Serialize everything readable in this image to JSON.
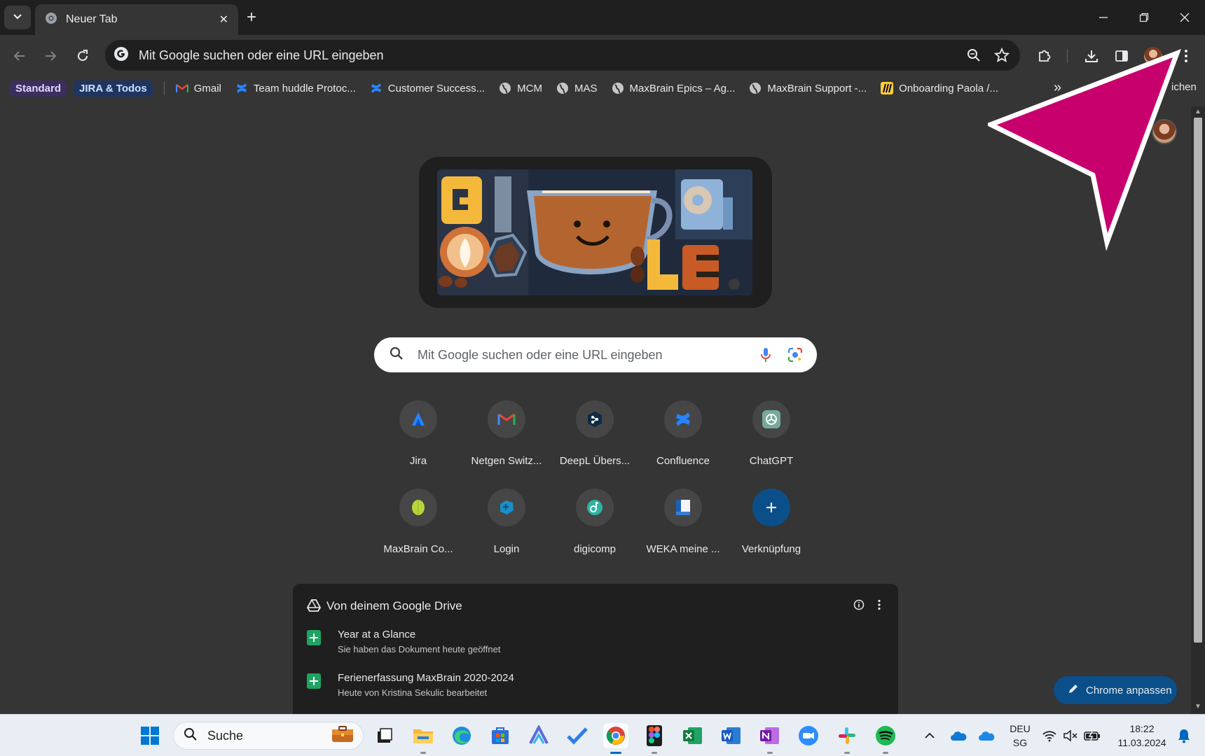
{
  "browser": {
    "tab": {
      "title": "Neuer Tab"
    },
    "omnibox": {
      "text": "Mit Google suchen oder eine URL eingeben"
    },
    "bookmarks": {
      "groups": [
        {
          "label": "Standard",
          "bg": "#3a2f5e",
          "fg": "#e5d7ff"
        },
        {
          "label": "JIRA & Todos",
          "bg": "#1f3560",
          "fg": "#cfe0ff"
        }
      ],
      "items": [
        {
          "label": "Gmail",
          "icon": "gmail-icon"
        },
        {
          "label": "Team huddle Protoc...",
          "icon": "confluence-icon"
        },
        {
          "label": "Customer Success...",
          "icon": "confluence-icon"
        },
        {
          "label": "MCM",
          "icon": "globe-icon"
        },
        {
          "label": "MAS",
          "icon": "globe-icon"
        },
        {
          "label": "MaxBrain Epics – Ag...",
          "icon": "globe-icon"
        },
        {
          "label": "MaxBrain Support -...",
          "icon": "globe-icon"
        },
        {
          "label": "Onboarding Paola /...",
          "icon": "miro-icon"
        }
      ],
      "more": "»",
      "right_fragment": "ichen"
    }
  },
  "newtab": {
    "search": {
      "placeholder": "Mit Google suchen oder eine URL eingeben"
    },
    "shortcuts": [
      {
        "label": "Jira",
        "icon": "jira-icon"
      },
      {
        "label": "Netgen Switz...",
        "icon": "gmail-icon"
      },
      {
        "label": "DeepL Übers...",
        "icon": "deepl-icon"
      },
      {
        "label": "Confluence",
        "icon": "confluence-icon"
      },
      {
        "label": "ChatGPT",
        "icon": "chatgpt-icon"
      },
      {
        "label": "MaxBrain Co...",
        "icon": "maxbrain-icon"
      },
      {
        "label": "Login",
        "icon": "login-icon"
      },
      {
        "label": "digicomp",
        "icon": "digicomp-icon"
      },
      {
        "label": "WEKA meine ...",
        "icon": "weka-icon"
      },
      {
        "label": "Verknüpfung",
        "icon": "plus-icon"
      }
    ],
    "drive": {
      "title": "Von deinem Google Drive",
      "files": [
        {
          "title": "Year at a Glance",
          "subtitle": "Sie haben das Dokument heute geöffnet"
        },
        {
          "title": "Ferienerfassung MaxBrain 2020-2024",
          "subtitle": "Heute von Kristina Sekulic bearbeitet"
        }
      ]
    },
    "customize_label": "Chrome anpassen"
  },
  "taskbar": {
    "search_label": "Suche",
    "language": {
      "line1": "DEU",
      "line2": "SG"
    },
    "clock": {
      "time": "18:22",
      "date": "11.03.2024"
    }
  },
  "colors": {
    "annotation_arrow": "#c8006e",
    "accent": "#0b4f8a"
  }
}
